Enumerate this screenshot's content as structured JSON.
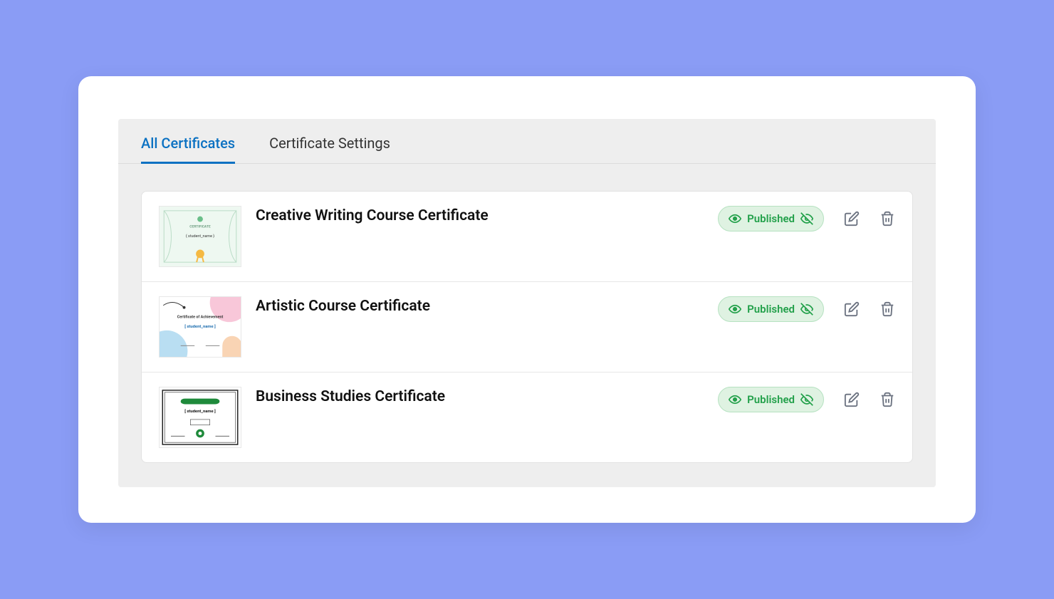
{
  "tabs": {
    "all": "All Certificates",
    "settings": "Certificate Settings"
  },
  "certificates": [
    {
      "title": "Creative Writing Course Certificate",
      "status": "Published"
    },
    {
      "title": "Artistic Course Certificate",
      "status": "Published"
    },
    {
      "title": "Business Studies Certificate",
      "status": "Published"
    }
  ]
}
